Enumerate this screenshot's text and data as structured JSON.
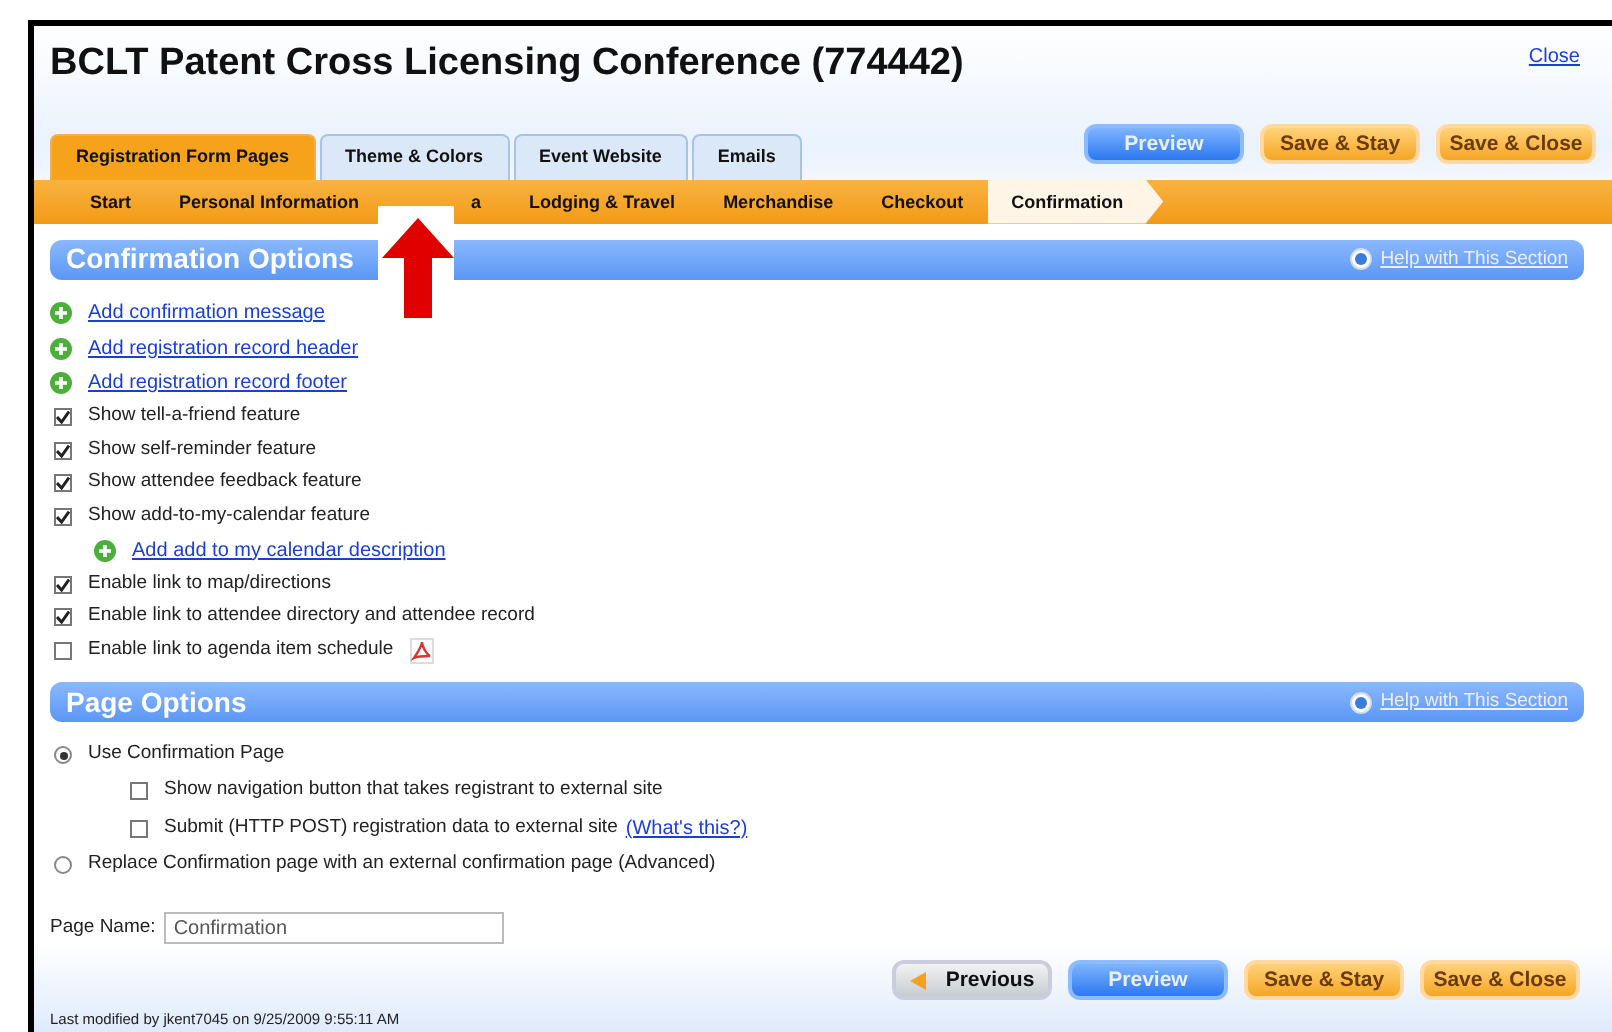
{
  "window": {
    "title": "BCLT Patent Cross Licensing Conference (774442)",
    "close": "Close"
  },
  "top_buttons": [
    {
      "label": "Preview",
      "kind": "blue"
    },
    {
      "label": "Save & Stay",
      "kind": "orange"
    },
    {
      "label": "Save & Close",
      "kind": "orange"
    }
  ],
  "tabs": [
    {
      "label": "Registration Form Pages",
      "selected": true
    },
    {
      "label": "Theme & Colors",
      "selected": false
    },
    {
      "label": "Event Website",
      "selected": false
    },
    {
      "label": "Emails",
      "selected": false
    }
  ],
  "steps": [
    {
      "label": "Start",
      "selected": false
    },
    {
      "label": "Personal Information",
      "selected": false
    },
    {
      "label": "a",
      "selected": false,
      "covered": true
    },
    {
      "label": "Lodging & Travel",
      "selected": false
    },
    {
      "label": "Merchandise",
      "selected": false
    },
    {
      "label": "Checkout",
      "selected": false
    },
    {
      "label": "Confirmation",
      "selected": true
    }
  ],
  "confirmation_options": {
    "title": "Confirmation Options",
    "help": "Help with This Section",
    "items": [
      {
        "kind": "add",
        "label": "Add confirmation message"
      },
      {
        "kind": "add",
        "label": "Add registration record header"
      },
      {
        "kind": "add",
        "label": "Add registration record footer"
      },
      {
        "kind": "check",
        "label": "Show tell-a-friend feature",
        "checked": true
      },
      {
        "kind": "check",
        "label": "Show self-reminder feature",
        "checked": true
      },
      {
        "kind": "check",
        "label": "Show attendee feedback feature",
        "checked": true
      },
      {
        "kind": "check",
        "label": "Show add-to-my-calendar feature",
        "checked": true
      },
      {
        "kind": "subadd",
        "label": "Add add to my calendar description"
      },
      {
        "kind": "check",
        "label": "Enable link to map/directions",
        "checked": true
      },
      {
        "kind": "check",
        "label": "Enable link to attendee directory and attendee record",
        "checked": true
      },
      {
        "kind": "check",
        "label": "Enable link to agenda item schedule",
        "checked": false,
        "pdf": true
      }
    ]
  },
  "page_options": {
    "title": "Page Options",
    "help": "Help with This Section",
    "items": [
      {
        "kind": "radio",
        "label": "Use Confirmation Page",
        "selected": true
      },
      {
        "kind": "subcheck",
        "label": "Show navigation button that takes registrant to external site",
        "checked": false
      },
      {
        "kind": "subcheck",
        "label": "Submit (HTTP POST) registration data to external site",
        "checked": false,
        "link": "(What's this?)"
      },
      {
        "kind": "radio",
        "label": "Replace Confirmation page with an external confirmation page (Advanced)",
        "selected": false
      }
    ],
    "page_name": {
      "label": "Page Name:",
      "value": "Confirmation"
    }
  },
  "footer": {
    "modified": "Last modified by jkent7045 on 9/25/2009 9:55:11 AM",
    "buttons": [
      {
        "label": "Previous",
        "kind": "grey"
      },
      {
        "label": "Preview",
        "kind": "blue"
      },
      {
        "label": "Save & Stay",
        "kind": "orange"
      },
      {
        "label": "Save & Close",
        "kind": "orange"
      }
    ]
  }
}
